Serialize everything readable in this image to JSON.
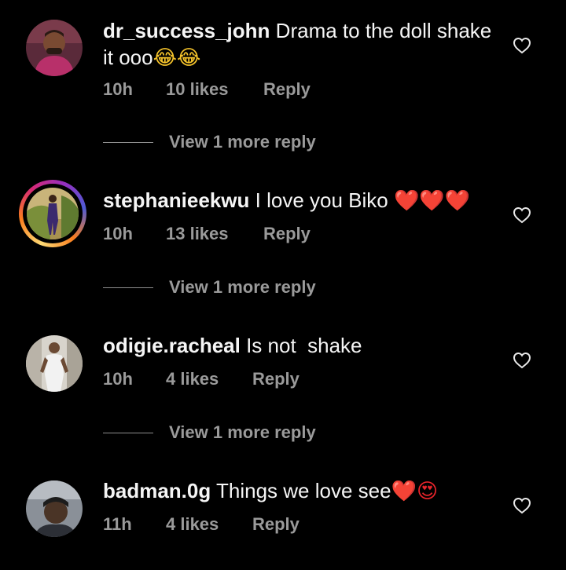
{
  "comments": [
    {
      "username": "dr_success_john",
      "text": "Drama to the doll shake it ooo",
      "emoji": "😂😂",
      "time": "10h",
      "likes": "10 likes",
      "reply": "Reply",
      "view_replies": "View 1 more reply",
      "has_story": false
    },
    {
      "username": "stephanieekwu",
      "text": "I love you Biko",
      "emoji": "❤️❤️❤️",
      "time": "10h",
      "likes": "13 likes",
      "reply": "Reply",
      "view_replies": "View 1 more reply",
      "has_story": true
    },
    {
      "username": "odigie.racheal",
      "text": "Is not  shake",
      "emoji": "",
      "time": "10h",
      "likes": "4 likes",
      "reply": "Reply",
      "view_replies": "View 1 more reply",
      "has_story": false
    },
    {
      "username": "badman.0g",
      "text": "Things we love see",
      "emoji": "❤️😍",
      "time": "11h",
      "likes": "4 likes",
      "reply": "Reply",
      "has_story": false
    }
  ],
  "icons": {
    "like": "heart-outline-icon"
  },
  "colors": {
    "background": "#000000",
    "primary_text": "#f5f5f5",
    "secondary_text": "#9a9a9a"
  }
}
